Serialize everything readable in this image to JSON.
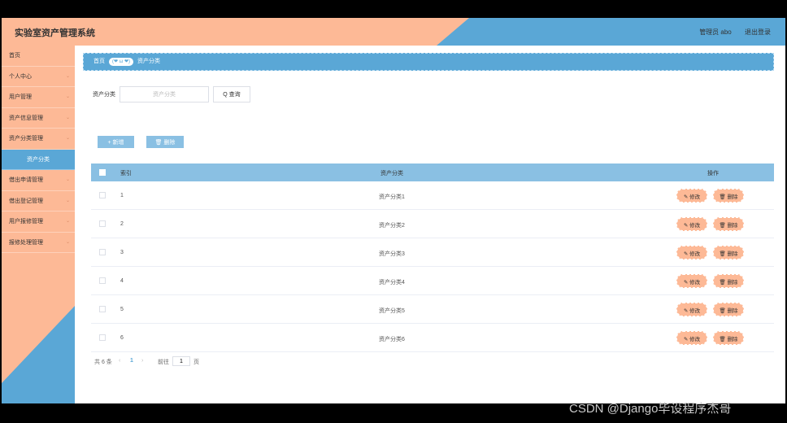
{
  "header": {
    "title": "实验室资产管理系统",
    "admin_label": "管理员 abo",
    "logout_label": "退出登录"
  },
  "sidebar": {
    "items": [
      {
        "label": "首页",
        "chevron": ""
      },
      {
        "label": "个人中心",
        "chevron": "⌄"
      },
      {
        "label": "用户管理",
        "chevron": "⌄"
      },
      {
        "label": "资产信息管理",
        "chevron": "⌄"
      },
      {
        "label": "资产分类管理",
        "chevron": "⌄"
      },
      {
        "label": "资产分类",
        "chevron": ""
      },
      {
        "label": "借出申请管理",
        "chevron": "⌄"
      },
      {
        "label": "借出登记管理",
        "chevron": "⌄"
      },
      {
        "label": "用户报修管理",
        "chevron": "⌄"
      },
      {
        "label": "报修处理管理",
        "chevron": "⌄"
      }
    ]
  },
  "breadcrumb": {
    "home": "首页",
    "face": "(❤ ω ❤)",
    "current": "资产分类"
  },
  "search": {
    "label": "资产分类",
    "placeholder": "资产分类",
    "query_label": "Q 查询"
  },
  "actions": {
    "add_label": "+ 新增",
    "delete_label": "🗑 删除"
  },
  "table": {
    "headers": {
      "index": "索引",
      "category": "资产分类",
      "ops": "操作"
    },
    "edit_label": "✎ 修改",
    "delete_label": "🗑 删除",
    "rows": [
      {
        "index": "1",
        "category": "资产分类1"
      },
      {
        "index": "2",
        "category": "资产分类2"
      },
      {
        "index": "3",
        "category": "资产分类3"
      },
      {
        "index": "4",
        "category": "资产分类4"
      },
      {
        "index": "5",
        "category": "资产分类5"
      },
      {
        "index": "6",
        "category": "资产分类6"
      }
    ]
  },
  "pagination": {
    "total": "共 6 条",
    "prev": "‹",
    "current": "1",
    "next": "›",
    "goto": "前往",
    "goto_value": "1",
    "page_unit": "页"
  },
  "watermark": "CSDN @Django毕设程序杰哥",
  "colors": {
    "peach": "#fdb996",
    "blue": "#5aa7d6",
    "light_blue": "#8ac0e3"
  }
}
